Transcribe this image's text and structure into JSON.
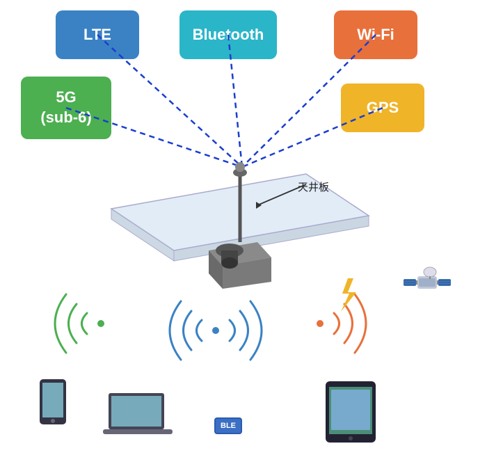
{
  "labels": {
    "lte": "LTE",
    "bluetooth": "Bluetooth",
    "wifi": "Wi-Fi",
    "5g": "5G\n(sub-6)",
    "gps": "GPS",
    "ceiling": "天井板",
    "ble": "BLE"
  },
  "colors": {
    "lte": "#3b82c4",
    "bluetooth": "#2bb5c8",
    "wifi": "#e8703a",
    "5g": "#4caf50",
    "gps": "#f0b429",
    "signal_green": "#4caf50",
    "signal_blue": "#3b82c4",
    "signal_orange": "#e8703a",
    "dash_line": "#1a3ecf",
    "lightning": "#f0b429"
  }
}
